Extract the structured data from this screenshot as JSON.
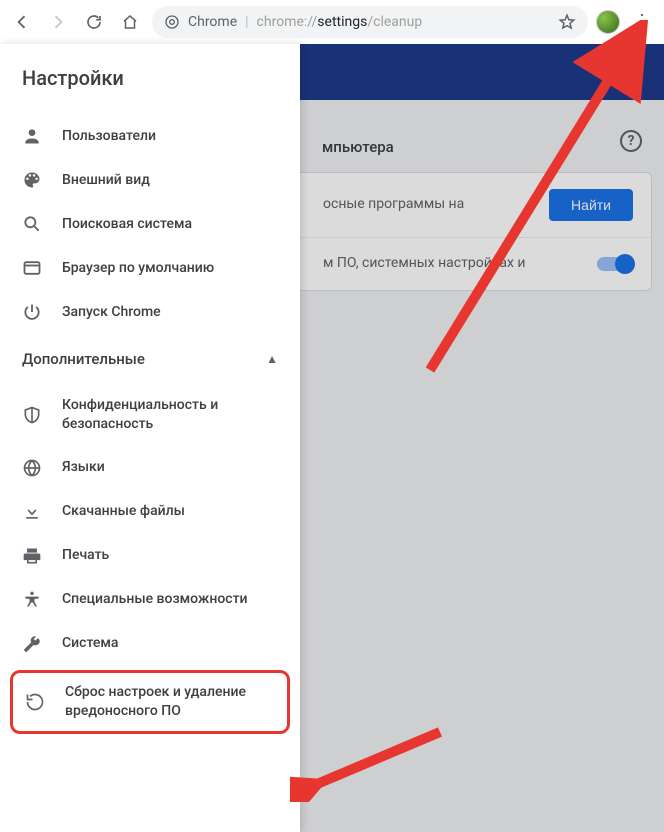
{
  "toolbar": {
    "product": "Chrome",
    "url_prefix": "chrome://",
    "url_bold": "settings",
    "url_suffix": "/cleanup"
  },
  "sidebar": {
    "title": "Настройки",
    "items": [
      {
        "label": "Пользователи"
      },
      {
        "label": "Внешний вид"
      },
      {
        "label": "Поисковая система"
      },
      {
        "label": "Браузер по умолчанию"
      },
      {
        "label": "Запуск Chrome"
      }
    ],
    "advanced_label": "Дополнительные",
    "advanced_items": [
      {
        "label": "Конфиденциальность и безопасность"
      },
      {
        "label": "Языки"
      },
      {
        "label": "Скачанные файлы"
      },
      {
        "label": "Печать"
      },
      {
        "label": "Специальные возможности"
      },
      {
        "label": "Система"
      },
      {
        "label": "Сброс настроек и удаление вредоносного ПО"
      }
    ]
  },
  "content": {
    "section_title": "мпьютера",
    "row1_text": "осные программы на",
    "find_label": "Найти",
    "row2_text": "м ПО, системных настройках и"
  }
}
